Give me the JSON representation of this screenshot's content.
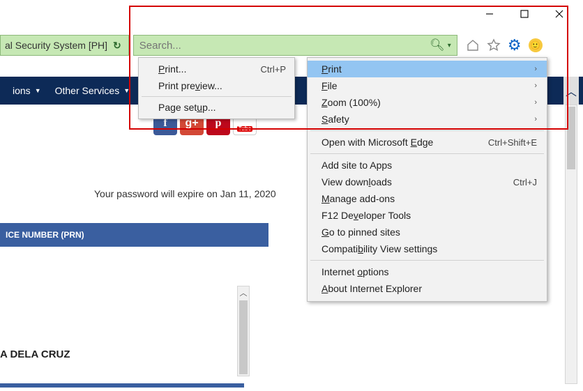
{
  "window": {
    "tab_title": "al Security System [PH]"
  },
  "search": {
    "placeholder": "Search..."
  },
  "nav": {
    "item1": "ions",
    "item2": "Other Services"
  },
  "page": {
    "pw_msg": "Your password will expire on Jan 11, 2020",
    "banner": "ICE NUMBER (PRN)",
    "name": "A DELA CRUZ"
  },
  "social": {
    "fb": "f",
    "gp": "g+",
    "pi": "p",
    "yt_top": "You",
    "yt_bot": "Tube"
  },
  "submenu": {
    "print": "Print...",
    "print_sc": "Ctrl+P",
    "preview": "Print preview...",
    "setup": "Page setup..."
  },
  "menu": {
    "print": "Print",
    "file": "File",
    "zoom": "Zoom (100%)",
    "safety": "Safety",
    "edge": "Open with Microsoft Edge",
    "edge_sc": "Ctrl+Shift+E",
    "apps": "Add site to Apps",
    "downloads": "View downloads",
    "downloads_sc": "Ctrl+J",
    "addons": "Manage add-ons",
    "f12": "F12 Developer Tools",
    "pinned": "Go to pinned sites",
    "compat": "Compatibility View settings",
    "options": "Internet options",
    "about": "About Internet Explorer"
  }
}
